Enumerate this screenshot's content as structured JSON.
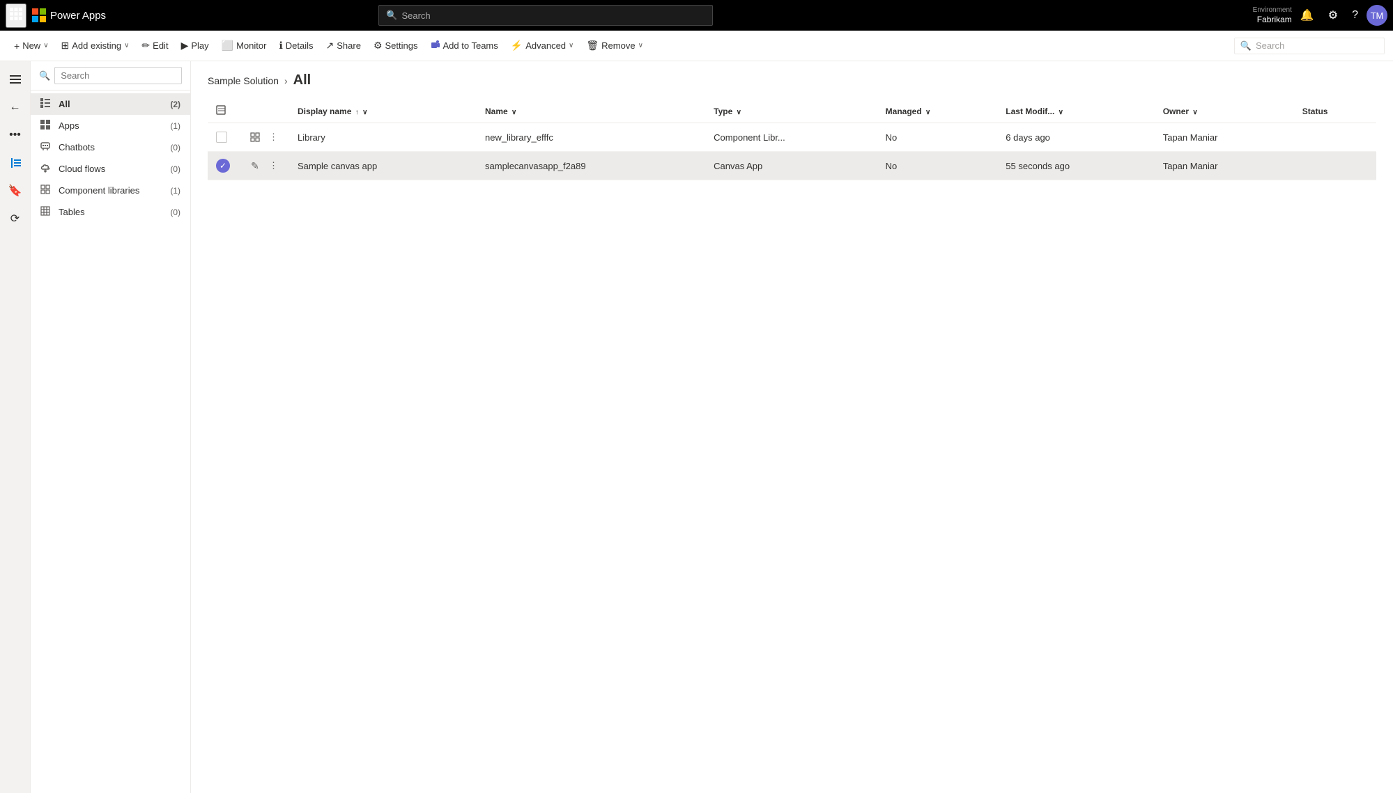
{
  "topbar": {
    "waffle_label": "⊞",
    "brand": "Power Apps",
    "search_placeholder": "Search",
    "env_label": "Environment",
    "env_name": "Fabrikam",
    "avatar_initials": "TM"
  },
  "cmdbar": {
    "new_label": "New",
    "add_existing_label": "Add existing",
    "edit_label": "Edit",
    "play_label": "Play",
    "monitor_label": "Monitor",
    "details_label": "Details",
    "share_label": "Share",
    "settings_label": "Settings",
    "add_to_teams_label": "Add to Teams",
    "advanced_label": "Advanced",
    "remove_label": "Remove",
    "search_placeholder": "Search"
  },
  "sidebar": {
    "search_placeholder": "Search",
    "items": [
      {
        "id": "all",
        "label": "All",
        "count": "(2)",
        "icon": "≡"
      },
      {
        "id": "apps",
        "label": "Apps",
        "count": "(1)",
        "icon": "⊞"
      },
      {
        "id": "chatbots",
        "label": "Chatbots",
        "count": "(0)",
        "icon": "💬"
      },
      {
        "id": "cloud-flows",
        "label": "Cloud flows",
        "count": "(0)",
        "icon": "↻"
      },
      {
        "id": "component-libraries",
        "label": "Component libraries",
        "count": "(1)",
        "icon": "⊟"
      },
      {
        "id": "tables",
        "label": "Tables",
        "count": "(0)",
        "icon": "⊞"
      }
    ]
  },
  "breadcrumb": {
    "parent": "Sample Solution",
    "current": "All"
  },
  "table": {
    "columns": [
      {
        "id": "display-name",
        "label": "Display name",
        "sortable": true,
        "sort_dir": "asc"
      },
      {
        "id": "name",
        "label": "Name",
        "sortable": true
      },
      {
        "id": "type",
        "label": "Type",
        "sortable": true
      },
      {
        "id": "managed",
        "label": "Managed",
        "sortable": true
      },
      {
        "id": "last-modified",
        "label": "Last Modif...",
        "sortable": true
      },
      {
        "id": "owner",
        "label": "Owner",
        "sortable": true
      },
      {
        "id": "status",
        "label": "Status",
        "sortable": false
      }
    ],
    "rows": [
      {
        "id": "library",
        "display_name": "Library",
        "name": "new_library_efffc",
        "type": "Component Libr...",
        "managed": "No",
        "last_modified": "6 days ago",
        "owner": "Tapan Maniar",
        "status": "",
        "selected": false
      },
      {
        "id": "sample-canvas-app",
        "display_name": "Sample canvas app",
        "name": "samplecanvasapp_f2a89",
        "type": "Canvas App",
        "managed": "No",
        "last_modified": "55 seconds ago",
        "owner": "Tapan Maniar",
        "status": "",
        "selected": true
      }
    ]
  },
  "icons": {
    "waffle": "⊞",
    "back": "←",
    "more": "•••",
    "list": "☰",
    "bookmark": "🔖",
    "history": "⟳",
    "search": "🔍",
    "new_plus": "+",
    "edit_pencil": "✏",
    "play_triangle": "▶",
    "monitor": "⬜",
    "details": "ℹ",
    "share": "↗",
    "settings_gear": "⚙",
    "teams": "T",
    "advanced_lightning": "⚡",
    "remove_trash": "🗑",
    "sort_asc": "↑",
    "sort_chevron": "∨",
    "notification_bell": "🔔",
    "help": "?",
    "check": "✓",
    "dots": "⋮",
    "pencil_small": "✎",
    "component_icon": "⊟",
    "chevron_right": "›"
  }
}
